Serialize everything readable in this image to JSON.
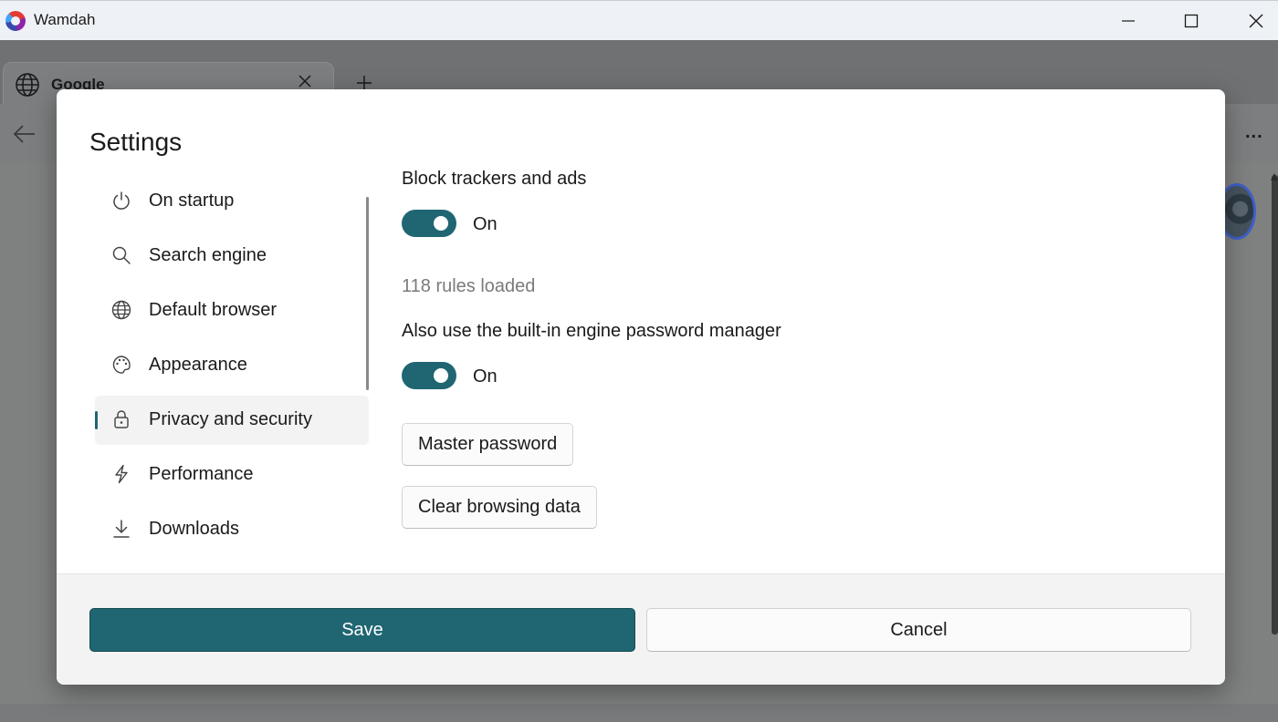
{
  "window": {
    "title": "Wamdah",
    "minimize_icon": "minimize-icon",
    "maximize_icon": "maximize-icon",
    "close_icon": "close-icon"
  },
  "browser": {
    "tabs": [
      {
        "title": "Google",
        "icon": "globe-icon"
      }
    ],
    "new_tab_icon": "plus-icon",
    "back_icon": "arrow-left-icon",
    "more_label": "..."
  },
  "settings": {
    "title": "Settings",
    "accent_color": "#1f6672",
    "nav": [
      {
        "label": "On startup",
        "icon": "power-icon",
        "selected": false
      },
      {
        "label": "Search engine",
        "icon": "search-icon",
        "selected": false
      },
      {
        "label": "Default browser",
        "icon": "globe-icon",
        "selected": false
      },
      {
        "label": "Appearance",
        "icon": "palette-icon",
        "selected": false
      },
      {
        "label": "Privacy and security",
        "icon": "lock-icon",
        "selected": true
      },
      {
        "label": "Performance",
        "icon": "lightning-icon",
        "selected": false
      },
      {
        "label": "Downloads",
        "icon": "download-icon",
        "selected": false
      }
    ],
    "privacy": {
      "block_trackers_label": "Block trackers and ads",
      "block_trackers_state": "On",
      "rules_loaded": "118 rules loaded",
      "password_manager_label": "Also use the built-in engine password manager",
      "password_manager_state": "On",
      "master_password_button": "Master password",
      "clear_data_button": "Clear browsing data"
    },
    "footer": {
      "save_label": "Save",
      "cancel_label": "Cancel"
    }
  }
}
